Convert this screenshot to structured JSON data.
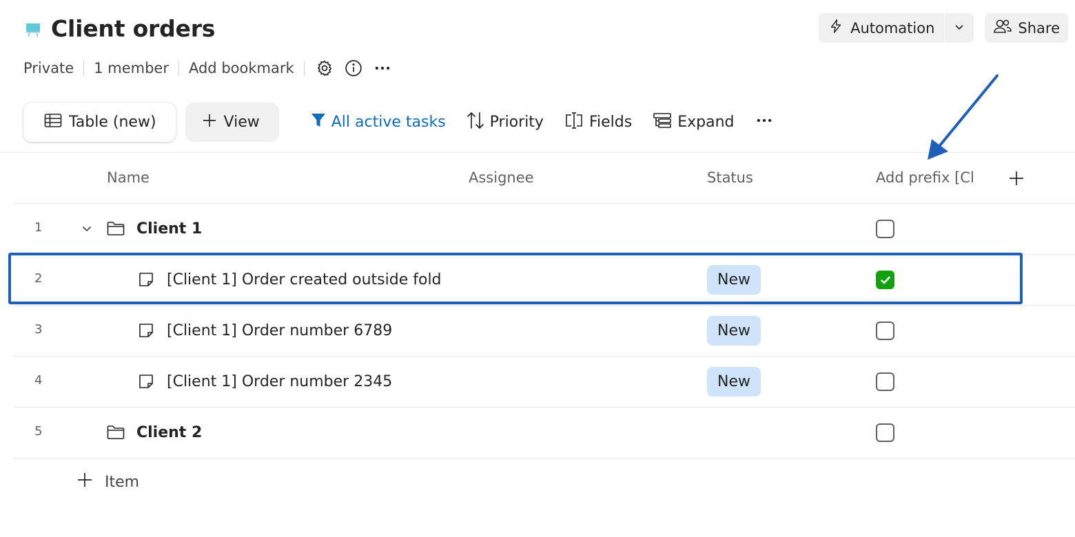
{
  "header": {
    "title": "Client orders",
    "meta": [
      "Private",
      "1 member",
      "Add bookmark"
    ]
  },
  "top_actions": {
    "automation_label": "Automation",
    "share_label": "Share"
  },
  "toolbar": {
    "active_view": "Table (new)",
    "add_view": "View",
    "filter": "All active tasks",
    "sort": "Priority",
    "fields": "Fields",
    "expand": "Expand"
  },
  "columns": {
    "name": "Name",
    "assignee": "Assignee",
    "status": "Status",
    "prefix": "Add prefix [Cl"
  },
  "rows": [
    {
      "num": "1",
      "name": "Client 1",
      "type": "folder",
      "status": "",
      "checked": false
    },
    {
      "num": "2",
      "name": "[Client 1] Order created outside fold",
      "type": "task",
      "status": "New",
      "checked": true
    },
    {
      "num": "3",
      "name": "[Client 1] Order number 6789",
      "type": "task",
      "status": "New",
      "checked": false
    },
    {
      "num": "4",
      "name": "[Client 1] Order number 2345",
      "type": "task",
      "status": "New",
      "checked": false
    },
    {
      "num": "5",
      "name": "Client 2",
      "type": "folder",
      "status": "",
      "checked": false
    }
  ],
  "add_item_label": "Item",
  "colors": {
    "accent": "#0f6cbd",
    "status_pill": "#cfe4fa",
    "checked": "#13a10e",
    "highlight": "#1f5fb8"
  }
}
